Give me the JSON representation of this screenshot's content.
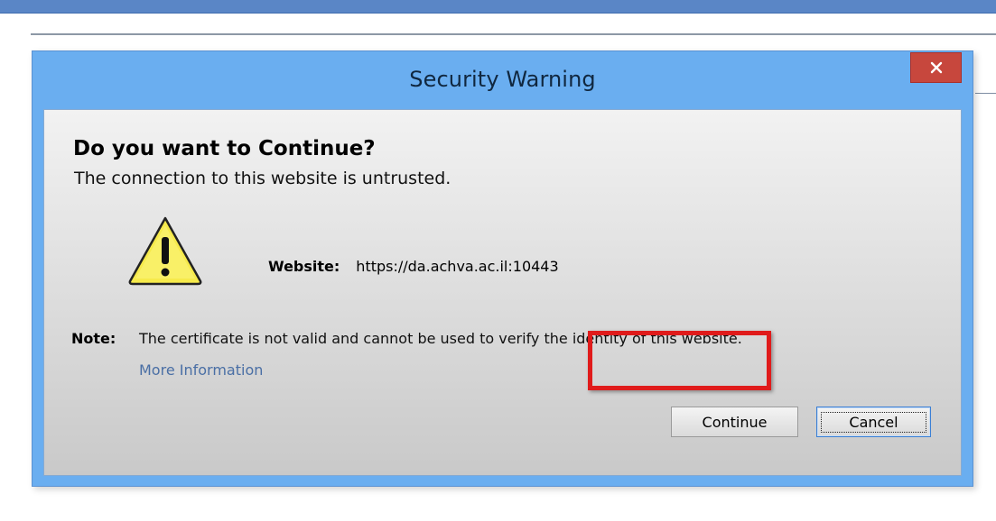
{
  "dialog": {
    "title": "Security Warning",
    "close_symbol": "×",
    "heading": "Do you want to Continue?",
    "subheading": "The connection to this website is untrusted.",
    "icon": "warning-triangle-icon",
    "website_label": "Website:",
    "website_value": "https://da.achva.ac.il:10443",
    "note_label": "Note:",
    "note_text": "The certificate is not valid and cannot be used to verify the identity of this website.",
    "more_info_link": "More Information",
    "buttons": {
      "continue": "Continue",
      "cancel": "Cancel"
    }
  },
  "colors": {
    "title_bar": "#6aaef0",
    "close_button": "#c7473d",
    "highlight": "#e01b1b",
    "link": "#4a6fa5"
  }
}
